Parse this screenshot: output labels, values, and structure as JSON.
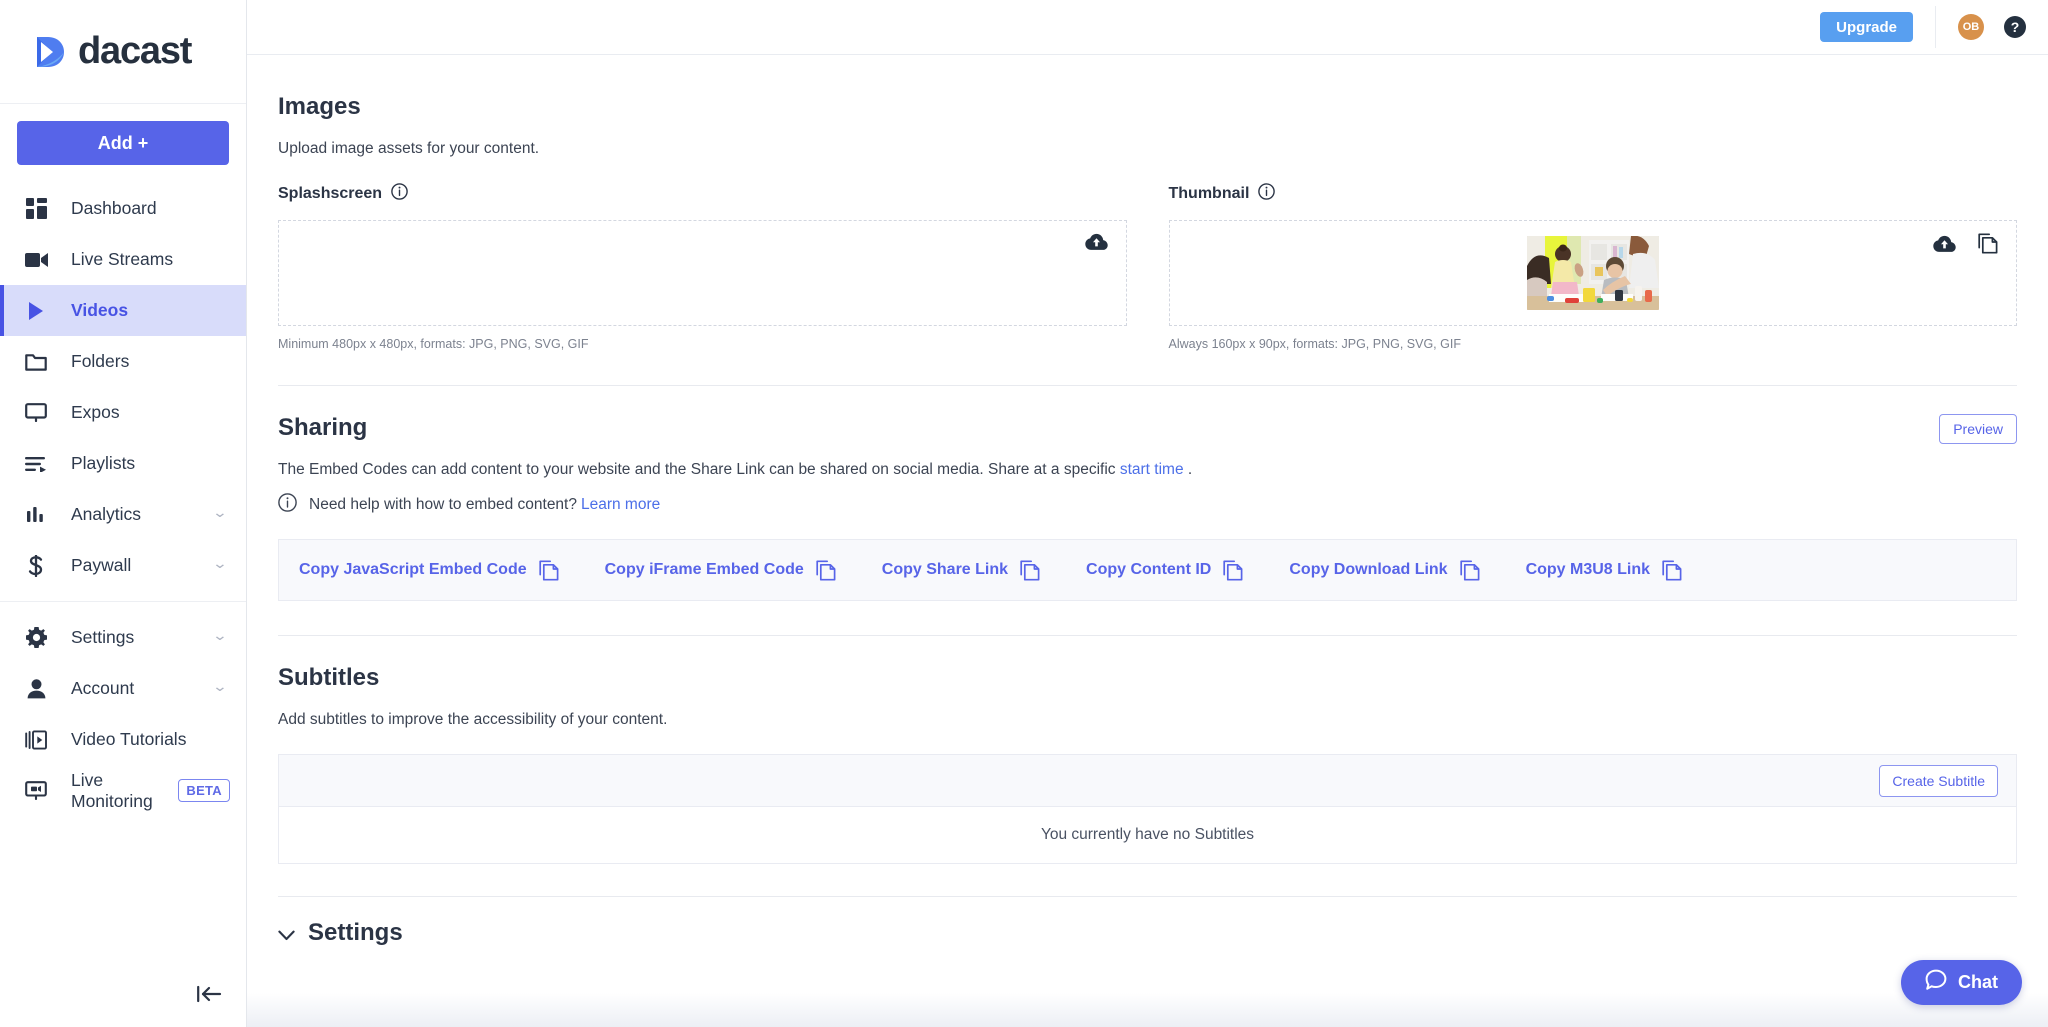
{
  "brand": {
    "name": "dacast",
    "accent": "#5764e8",
    "upgrade_accent": "#589ff0",
    "logo_icon": "dacast-play-logo"
  },
  "sidebar": {
    "add_button": "Add +",
    "groups": [
      {
        "items": [
          {
            "label": "Dashboard",
            "icon": "dashboard-icon",
            "active": false,
            "chevron": false
          },
          {
            "label": "Live Streams",
            "icon": "video-camera-icon",
            "active": false,
            "chevron": false
          },
          {
            "label": "Videos",
            "icon": "play-icon",
            "active": true,
            "chevron": false
          },
          {
            "label": "Folders",
            "icon": "folder-icon",
            "active": false,
            "chevron": false
          },
          {
            "label": "Expos",
            "icon": "monitor-icon",
            "active": false,
            "chevron": false
          },
          {
            "label": "Playlists",
            "icon": "playlist-icon",
            "active": false,
            "chevron": false
          },
          {
            "label": "Analytics",
            "icon": "bar-chart-icon",
            "active": false,
            "chevron": true
          },
          {
            "label": "Paywall",
            "icon": "dollar-icon",
            "active": false,
            "chevron": true
          }
        ]
      },
      {
        "items": [
          {
            "label": "Settings",
            "icon": "gear-icon",
            "active": false,
            "chevron": true
          },
          {
            "label": "Account",
            "icon": "person-icon",
            "active": false,
            "chevron": true
          },
          {
            "label": "Video Tutorials",
            "icon": "video-tutorials-icon",
            "active": false,
            "chevron": false
          },
          {
            "label": "Live Monitoring",
            "icon": "live-monitoring-icon",
            "active": false,
            "chevron": false,
            "badge": "BETA"
          }
        ]
      }
    ],
    "collapse_icon": "collapse-sidebar-icon"
  },
  "topbar": {
    "upgrade_label": "Upgrade",
    "avatar_initials": "OB",
    "help_icon": "help-question-icon"
  },
  "images": {
    "title": "Images",
    "description": "Upload image assets for your content.",
    "splashscreen": {
      "label": "Splashscreen",
      "info_icon": "info-icon",
      "upload_icon": "cloud-upload-icon",
      "hint": "Minimum 480px x 480px, formats: JPG, PNG, SVG, GIF",
      "has_image": false
    },
    "thumbnail": {
      "label": "Thumbnail",
      "info_icon": "info-icon",
      "upload_icon": "cloud-upload-icon",
      "copy_icon": "copy-icon",
      "hint": "Always 160px x 90px, formats: JPG, PNG, SVG, GIF",
      "has_image": true,
      "image_description": "children doing crafts at a table"
    }
  },
  "sharing": {
    "title": "Sharing",
    "preview_label": "Preview",
    "description_before": "The Embed Codes can add content to your website and the Share Link can be shared on social media. Share at a specific ",
    "description_link": "start time",
    "description_after": " .",
    "help_icon": "info-icon",
    "help_text": "Need help with how to embed content? ",
    "help_link": "Learn more",
    "copy_actions": [
      {
        "label": "Copy JavaScript Embed Code",
        "icon": "copy-icon"
      },
      {
        "label": "Copy iFrame Embed Code",
        "icon": "copy-icon"
      },
      {
        "label": "Copy Share Link",
        "icon": "copy-icon"
      },
      {
        "label": "Copy Content ID",
        "icon": "copy-icon"
      },
      {
        "label": "Copy Download Link",
        "icon": "copy-icon"
      },
      {
        "label": "Copy M3U8 Link",
        "icon": "copy-icon"
      }
    ]
  },
  "subtitles": {
    "title": "Subtitles",
    "description": "Add subtitles to improve the accessibility of your content.",
    "create_label": "Create Subtitle",
    "empty_text": "You currently have no Subtitles"
  },
  "settings_section": {
    "title": "Settings",
    "chevron_icon": "chevron-down-icon"
  },
  "chat": {
    "label": "Chat",
    "icon": "chat-bubble-icon"
  }
}
